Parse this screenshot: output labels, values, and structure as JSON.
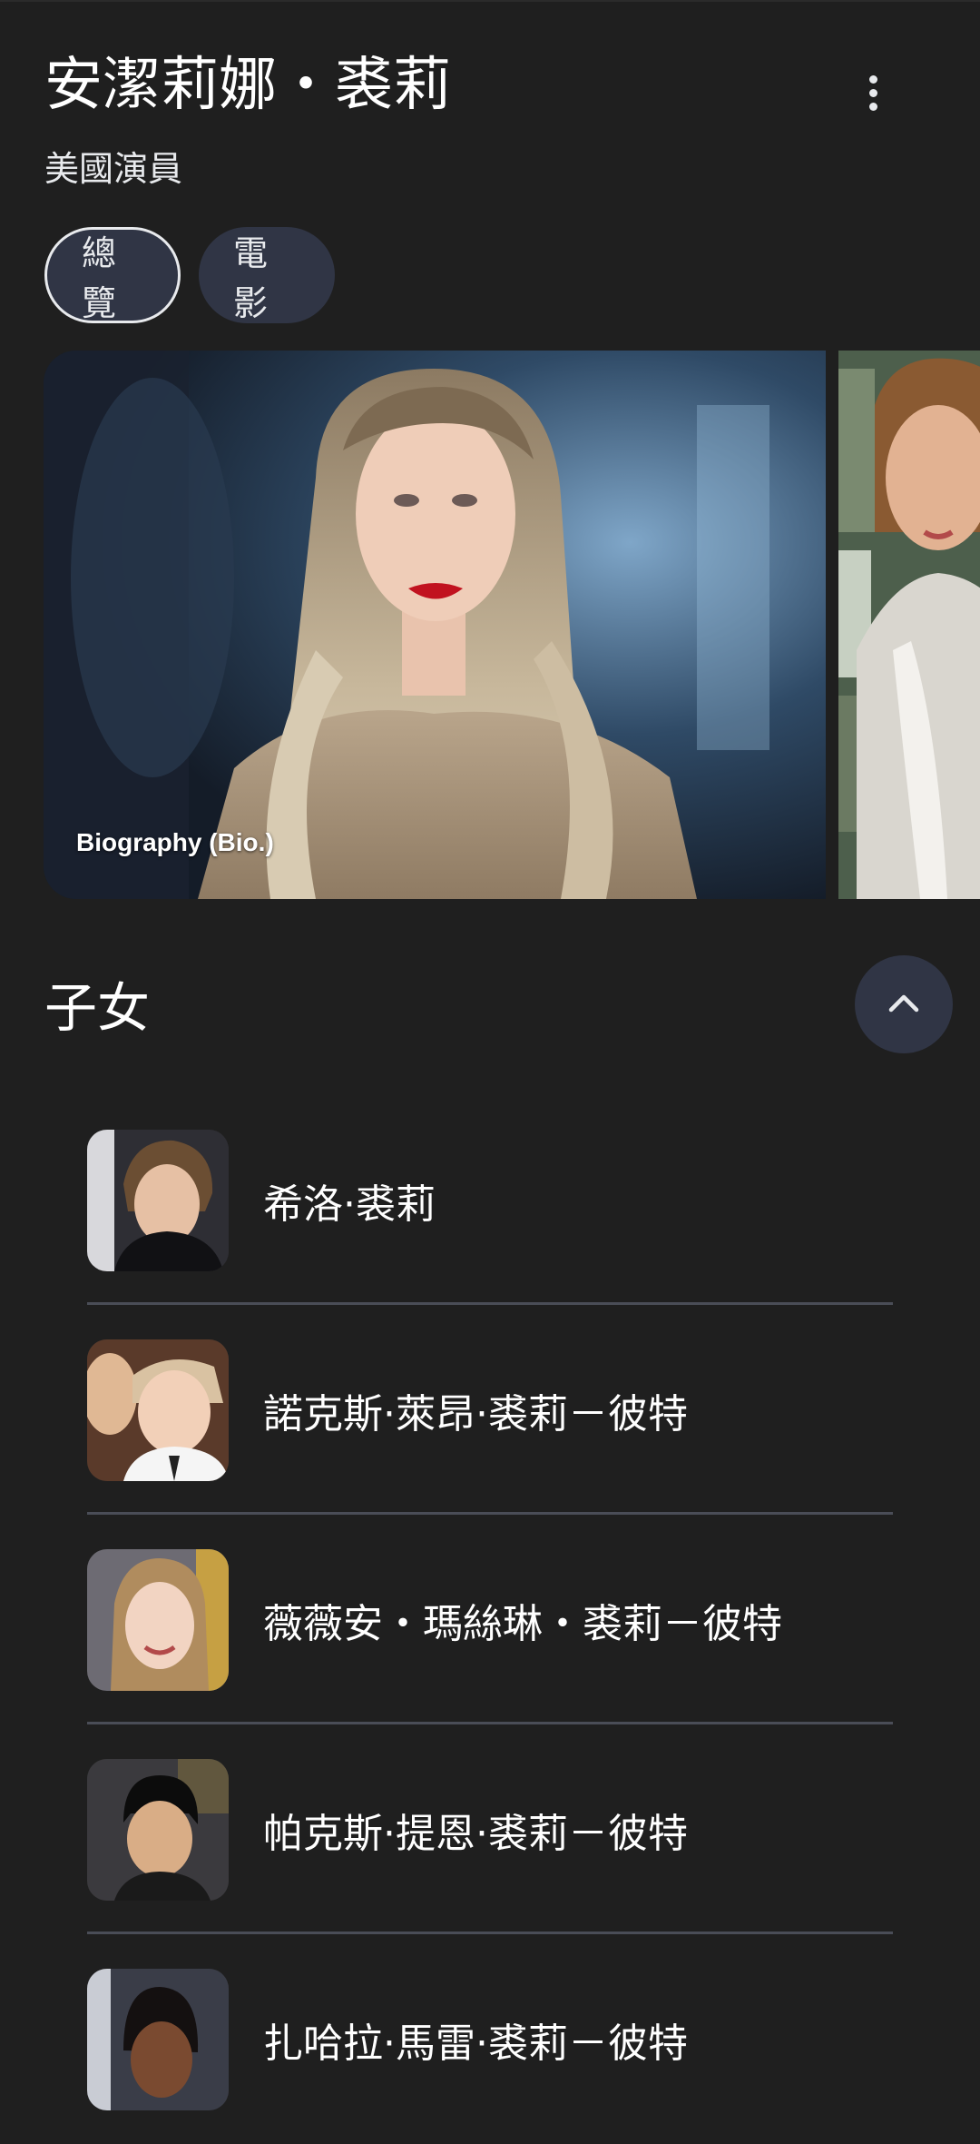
{
  "header": {
    "title": "安潔莉娜・裘莉",
    "subtitle": "美國演員",
    "more_icon": "more-vert-icon"
  },
  "tabs": [
    {
      "label": "總覽",
      "selected": true
    },
    {
      "label": "電影",
      "selected": false
    }
  ],
  "carousel": {
    "main_caption": "Biography (Bio.)"
  },
  "children_section": {
    "title": "子女",
    "toggle_icon": "chevron-up-icon",
    "items": [
      {
        "name": "希洛·裘莉"
      },
      {
        "name": "諾克斯·萊昂·裘莉－彼特"
      },
      {
        "name": "薇薇安・瑪絲琳・裘莉－彼特"
      },
      {
        "name": "帕克斯·提恩·裘莉－彼特"
      },
      {
        "name": "扎哈拉·馬雷·裘莉－彼特"
      }
    ]
  },
  "colors": {
    "background": "#1f1f1f",
    "chip_background": "#303545",
    "text_primary": "#ffffff",
    "divider": "#4a4d57"
  }
}
